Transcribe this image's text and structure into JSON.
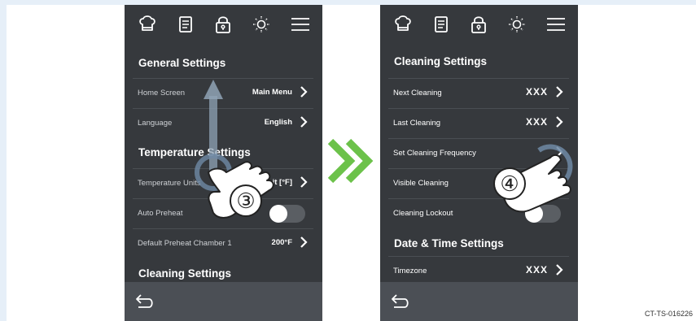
{
  "left_screen": {
    "sections": {
      "general": "General Settings",
      "temperature": "Temperature Settings",
      "cleaning": "Cleaning Settings"
    },
    "rows": {
      "home_screen": {
        "label": "Home Screen",
        "value": "Main Menu"
      },
      "language": {
        "label": "Language",
        "value": "English"
      },
      "temperature_units": {
        "label": "Temperature Units",
        "value": "Fahrenheit [°F]"
      },
      "auto_preheat": {
        "label": "Auto Preheat",
        "toggle": "off"
      },
      "default_preheat": {
        "label": "Default Preheat Chamber 1",
        "value": "200°F"
      }
    },
    "step": "③"
  },
  "right_screen": {
    "sections": {
      "cleaning": "Cleaning Settings",
      "datetime": "Date & Time Settings"
    },
    "rows": {
      "next_cleaning": {
        "label": "Next Cleaning",
        "value": "XXX"
      },
      "last_cleaning": {
        "label": "Last Cleaning",
        "value": "XXX"
      },
      "set_frequency": {
        "label": "Set Cleaning Frequency"
      },
      "visible_cleaning": {
        "label": "Visible Cleaning"
      },
      "cleaning_lockout": {
        "label": "Cleaning Lockout",
        "toggle": "off"
      },
      "timezone": {
        "label": "Timezone",
        "value": "XXX"
      }
    },
    "step": "④"
  },
  "topbar_icons": [
    "chef-hat-icon",
    "recipe-book-icon",
    "lock-icon",
    "brightness-icon",
    "menu-icon"
  ],
  "colors": {
    "screen_bg": "#36393d",
    "bottom_bar": "#4b4f55",
    "accent_green": "#6cc24a",
    "frame": "#e6eff8"
  },
  "figure_code": "CT-TS-016226"
}
